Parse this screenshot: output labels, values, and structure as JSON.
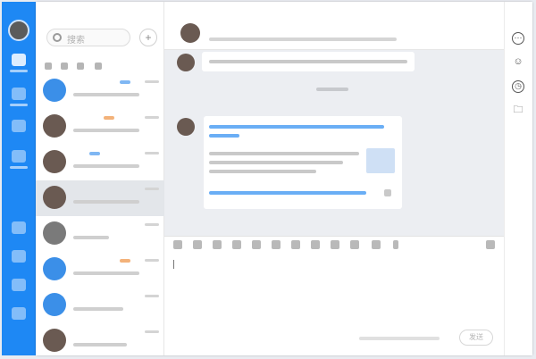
{
  "window": {
    "controls": {
      "minimize": "–",
      "maximize": "⧉",
      "close": "✕"
    }
  },
  "sidebar": {
    "items": [
      {
        "icon": "chat-icon",
        "active": true
      },
      {
        "icon": "contacts-icon"
      },
      {
        "icon": "workspace-icon"
      },
      {
        "icon": "calendar-icon"
      },
      {
        "icon": "apps-icon"
      },
      {
        "icon": "more-icon"
      }
    ]
  },
  "contacts": {
    "search_placeholder": "搜索",
    "add_label": "+",
    "items": [
      {
        "name": "",
        "tag": "blue"
      },
      {
        "name": "",
        "tag": "orange"
      },
      {
        "name": "",
        "tag": "blue"
      },
      {
        "name": "",
        "active": true
      },
      {
        "name": ""
      },
      {
        "name": "",
        "tag": "orange"
      },
      {
        "name": ""
      },
      {
        "name": ""
      }
    ]
  },
  "chat": {
    "header": {
      "name": ""
    },
    "send_label": "发送"
  },
  "actions": {
    "items": [
      {
        "icon": "more-options-icon"
      },
      {
        "icon": "add-member-icon"
      },
      {
        "icon": "history-icon"
      },
      {
        "icon": "folder-icon"
      }
    ]
  },
  "colors": {
    "rail": "#1e88f4",
    "link": "#6aaef5",
    "chat_bg": "#eceef2"
  }
}
